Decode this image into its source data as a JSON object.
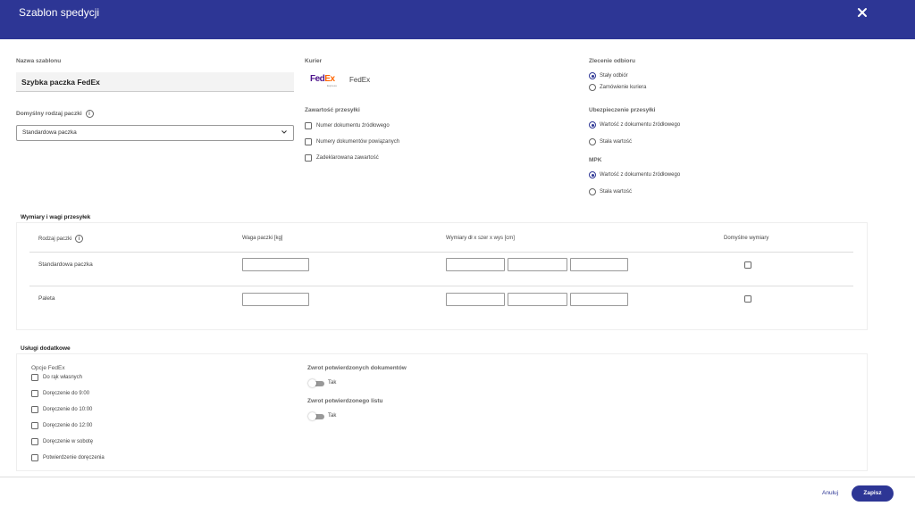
{
  "header": {
    "title": "Szablon spedycji"
  },
  "template": {
    "name_label": "Nazwa szablonu",
    "name_value": "Szybka paczka FedEx",
    "default_package_label": "Domyślny rodzaj paczki",
    "default_package_value": "Standardowa paczka"
  },
  "courier": {
    "label": "Kurier",
    "logo_fed": "Fed",
    "logo_ex": "Ex",
    "logo_sub": "Express",
    "name": "FedEx"
  },
  "pickup": {
    "label": "Zlecenie odbioru",
    "options": [
      "Stały odbiór",
      "Zamówienie kuriera"
    ]
  },
  "contents": {
    "label": "Zawartość przesyłki",
    "options": [
      "Numer dokumentu źródłowego",
      "Numery dokumentów powiązanych",
      "Zadeklarowana zawartość"
    ]
  },
  "insurance": {
    "label": "Ubezpieczenie przesyłki",
    "options": [
      "Wartość z dokumentu źródłowego",
      "Stała wartość"
    ]
  },
  "mpk": {
    "label": "MPK",
    "options": [
      "Wartość z dokumentu źródłowego",
      "Stała wartość"
    ]
  },
  "dimensions": {
    "title": "Wymiary i wagi przesyłek",
    "headers": [
      "Rodzaj paczki",
      "Waga paczki [kg]",
      "Wymiary dł x szer x wys [cm]",
      "Domyślne wymiary"
    ],
    "rows": [
      "Standardowa paczka",
      "Paleta"
    ]
  },
  "services": {
    "title": "Usługi dodatkowe",
    "fedex_options_label": "Opcje FedEx",
    "fedex_options": [
      "Do rąk własnych",
      "Doręczenie do 9:00",
      "Doręczenie do 10:00",
      "Doręczenie do 12:00",
      "Doręczenie w sobotę",
      "Potwierdzenie doręczenia"
    ],
    "return_docs_label": "Zwrot potwierdzonych dokumentów",
    "return_docs_toggle": "Tak",
    "return_letter_label": "Zwrot potwierdzonego listu",
    "return_letter_toggle": "Tak"
  },
  "footer": {
    "cancel": "Anuluj",
    "save": "Zapisz"
  }
}
